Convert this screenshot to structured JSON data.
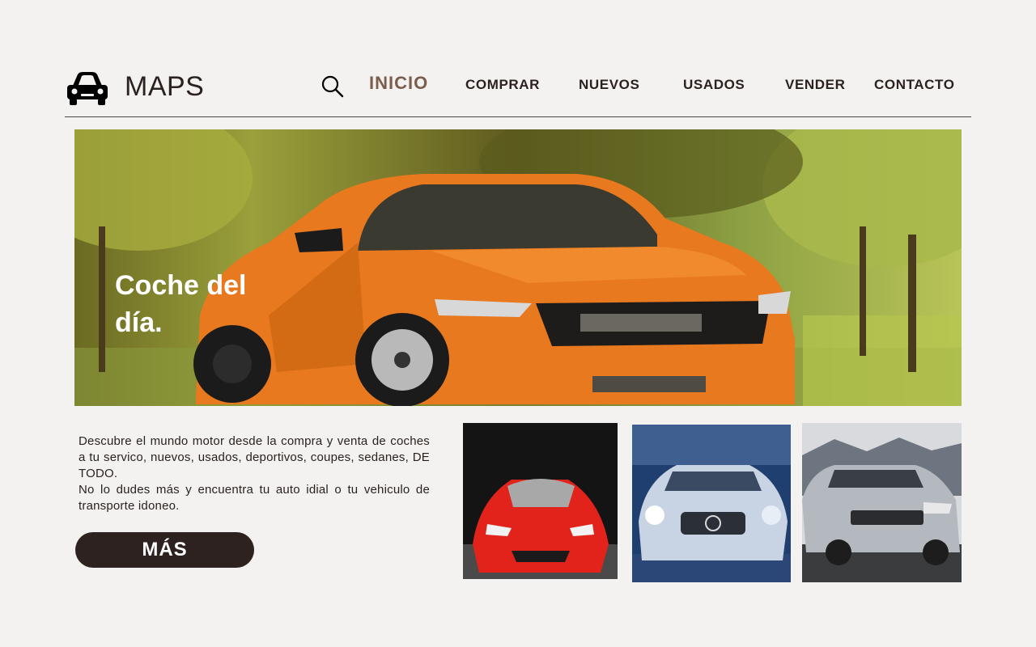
{
  "brand": {
    "name": "MAPS",
    "icon": "car-icon"
  },
  "nav": {
    "search_icon": "search-icon",
    "items": [
      {
        "label": "INICIO",
        "active": true
      },
      {
        "label": "COMPRAR",
        "active": false
      },
      {
        "label": "NUEVOS",
        "active": false
      },
      {
        "label": "USADOS",
        "active": false
      },
      {
        "label": "VENDER",
        "active": false
      },
      {
        "label": "CONTACTO",
        "active": false
      }
    ]
  },
  "hero": {
    "line1": "Coche del",
    "line2": "día."
  },
  "description": {
    "paragraph1": "Descubre el mundo motor desde la compra y venta de coches a tu servico, nuevos, usados, deportivos, coupes, sedanes, DE TODO.",
    "paragraph2": "No lo dudes más y encuentra tu auto idial o tu vehiculo de transporte idoneo."
  },
  "cta": {
    "label": "MÁS"
  },
  "colors": {
    "background": "#f4f2f0",
    "text": "#2b221f",
    "accent": "#7b5d4c",
    "button": "#2e2220",
    "hero_car": "#e8791e"
  }
}
